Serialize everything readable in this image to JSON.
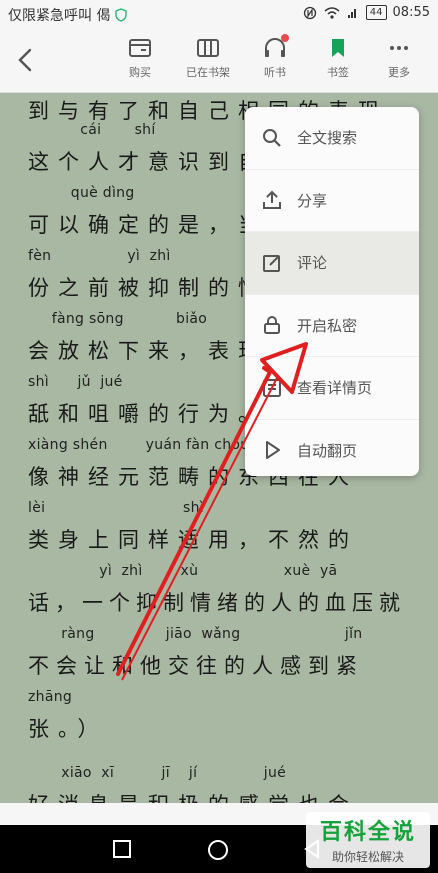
{
  "status": {
    "carrier": "仅限紧急呼叫 偈",
    "battery": "44",
    "time": "08:55"
  },
  "toolbar": {
    "items": [
      {
        "label": "购买",
        "icon": "card-icon"
      },
      {
        "label": "已在书架",
        "icon": "bookshelf-icon"
      },
      {
        "label": "听书",
        "icon": "headphones-icon"
      },
      {
        "label": "书签",
        "icon": "bookmark-icon"
      },
      {
        "label": "更多",
        "icon": "more-icon"
      }
    ]
  },
  "reader": {
    "lines": [
      {
        "pinyin": "",
        "text": "到与有了和自己相同的表现，"
      },
      {
        "pinyin": "           cái       shí",
        "text": "这个人才意识到自"
      },
      {
        "pinyin": "         què dìng",
        "text": "可以确定的是，当"
      },
      {
        "pinyin": "fèn                yì  zhì",
        "text": "份之前被抑制的情"
      },
      {
        "pinyin": "     fàng sōng           biǎo",
        "text": "会放松下来，表现"
      },
      {
        "pinyin": "shì      jǔ  jué",
        "text": "舐和咀嚼的行为。"
      },
      {
        "pinyin": "xiàng shén        yuán fàn chóu",
        "text": "像神经元范畴的东西在人"
      },
      {
        "pinyin": "lèi                             shì",
        "text": "类身上同样适用，不然的"
      },
      {
        "pinyin": "               yì  zhì        xù                  xuè  yā",
        "text": "话，一个抑制情绪的人的血压就"
      },
      {
        "pinyin": "       ràng               jiāo  wǎng                      jǐn",
        "text": "不会让和他交往的人感到紧"
      },
      {
        "pinyin": "zhāng",
        "text": "张。）"
      },
      {
        "pinyin": "       xiāo  xī          jī    jí              jué",
        "text": "好消息是积极的感觉也会"
      }
    ]
  },
  "menu": {
    "items": [
      {
        "label": "全文搜索",
        "icon": "search-icon"
      },
      {
        "label": "分享",
        "icon": "share-icon"
      },
      {
        "label": "评论",
        "icon": "edit-icon"
      },
      {
        "label": "开启私密",
        "icon": "lock-icon"
      },
      {
        "label": "查看详情页",
        "icon": "details-icon"
      },
      {
        "label": "自动翻页",
        "icon": "play-icon"
      }
    ]
  },
  "watermark": {
    "title": "百科全说",
    "subtitle": "助你轻松解决"
  },
  "colors": {
    "page_bg": "#a8b8a2",
    "accent_green": "#15a35a",
    "arrow_red": "#e02020"
  }
}
